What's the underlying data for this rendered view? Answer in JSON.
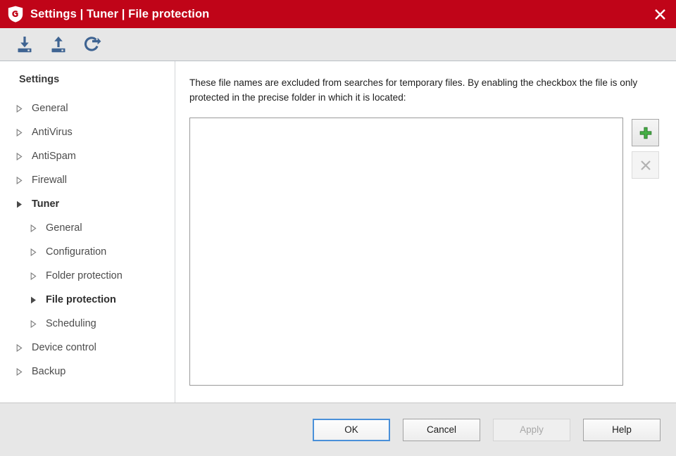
{
  "window": {
    "title": "Settings | Tuner | File protection",
    "logo_icon": "gdata-shield-icon",
    "close_icon": "close-icon",
    "titlebar_color": "#c00418",
    "toolbar_color": "#e7e7e7"
  },
  "toolbar": {
    "items": [
      {
        "name": "save-settings-button",
        "icon": "save-to-disk-icon",
        "tooltip": "Save settings"
      },
      {
        "name": "load-settings-button",
        "icon": "load-from-disk-icon",
        "tooltip": "Load settings"
      },
      {
        "name": "reset-settings-button",
        "icon": "reset-circular-arrow-icon",
        "tooltip": "Reset settings"
      }
    ],
    "icon_color": "#3f6492"
  },
  "sidebar": {
    "heading": "Settings",
    "items": [
      {
        "label": "General",
        "level": 1,
        "expanded": false,
        "active": false
      },
      {
        "label": "AntiVirus",
        "level": 1,
        "expanded": false,
        "active": false
      },
      {
        "label": "AntiSpam",
        "level": 1,
        "expanded": false,
        "active": false
      },
      {
        "label": "Firewall",
        "level": 1,
        "expanded": false,
        "active": false
      },
      {
        "label": "Tuner",
        "level": 1,
        "expanded": true,
        "active": true
      },
      {
        "label": "General",
        "level": 2,
        "expanded": false,
        "active": false
      },
      {
        "label": "Configuration",
        "level": 2,
        "expanded": false,
        "active": false
      },
      {
        "label": "Folder protection",
        "level": 2,
        "expanded": false,
        "active": false
      },
      {
        "label": "File protection",
        "level": 2,
        "expanded": true,
        "active": true
      },
      {
        "label": "Scheduling",
        "level": 2,
        "expanded": false,
        "active": false
      },
      {
        "label": "Device control",
        "level": 1,
        "expanded": false,
        "active": false
      },
      {
        "label": "Backup",
        "level": 1,
        "expanded": false,
        "active": false
      }
    ]
  },
  "main": {
    "description": "These file names are excluded from searches for temporary files. By enabling the checkbox the file is only protected in the precise folder in which it is located:",
    "list": {
      "name": "file-exclusions-list",
      "items": []
    },
    "side_buttons": [
      {
        "name": "add-entry-button",
        "icon": "plus-icon",
        "enabled": true,
        "color": "#3ea43e"
      },
      {
        "name": "remove-entry-button",
        "icon": "cross-icon",
        "enabled": false,
        "color": "#b0b0b0"
      }
    ]
  },
  "footer": {
    "buttons": [
      {
        "label": "OK",
        "name": "ok-button",
        "enabled": true,
        "default": true
      },
      {
        "label": "Cancel",
        "name": "cancel-button",
        "enabled": true,
        "default": false
      },
      {
        "label": "Apply",
        "name": "apply-button",
        "enabled": false,
        "default": false
      },
      {
        "label": "Help",
        "name": "help-button",
        "enabled": true,
        "default": false
      }
    ]
  }
}
